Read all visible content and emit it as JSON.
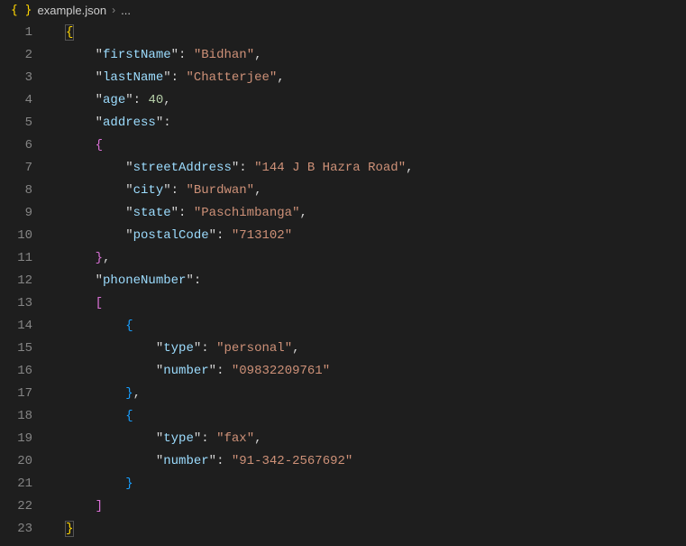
{
  "breadcrumb": {
    "filename": "example.json",
    "rest": "..."
  },
  "gutter": {
    "lines": [
      "1",
      "2",
      "3",
      "4",
      "5",
      "6",
      "7",
      "8",
      "9",
      "10",
      "11",
      "12",
      "13",
      "14",
      "15",
      "16",
      "17",
      "18",
      "19",
      "20",
      "21",
      "22",
      "23"
    ]
  },
  "q": "\"",
  "c": ",",
  "col": ":",
  "sp": " ",
  "code": {
    "l1_brace": "{",
    "firstName_key": "firstName",
    "firstName_val": "Bidhan",
    "lastName_key": "lastName",
    "lastName_val": "Chatterjee",
    "age_key": "age",
    "age_val": "40",
    "address_key": "address",
    "addr_open": "{",
    "streetAddress_key": "streetAddress",
    "streetAddress_val": "144 J B Hazra Road",
    "city_key": "city",
    "city_val": "Burdwan",
    "state_key": "state",
    "state_val": "Paschimbanga",
    "postalCode_key": "postalCode",
    "postalCode_val": "713102",
    "addr_close": "}",
    "phoneNumber_key": "phoneNumber",
    "phone_arr_open": "[",
    "phone_obj_open": "{",
    "type_key": "type",
    "type_val1": "personal",
    "number_key": "number",
    "number_val1": "09832209761",
    "phone_obj_close": "}",
    "type_val2": "fax",
    "number_val2": "91-342-2567692",
    "phone_arr_close": "]",
    "l23_brace": "}"
  }
}
